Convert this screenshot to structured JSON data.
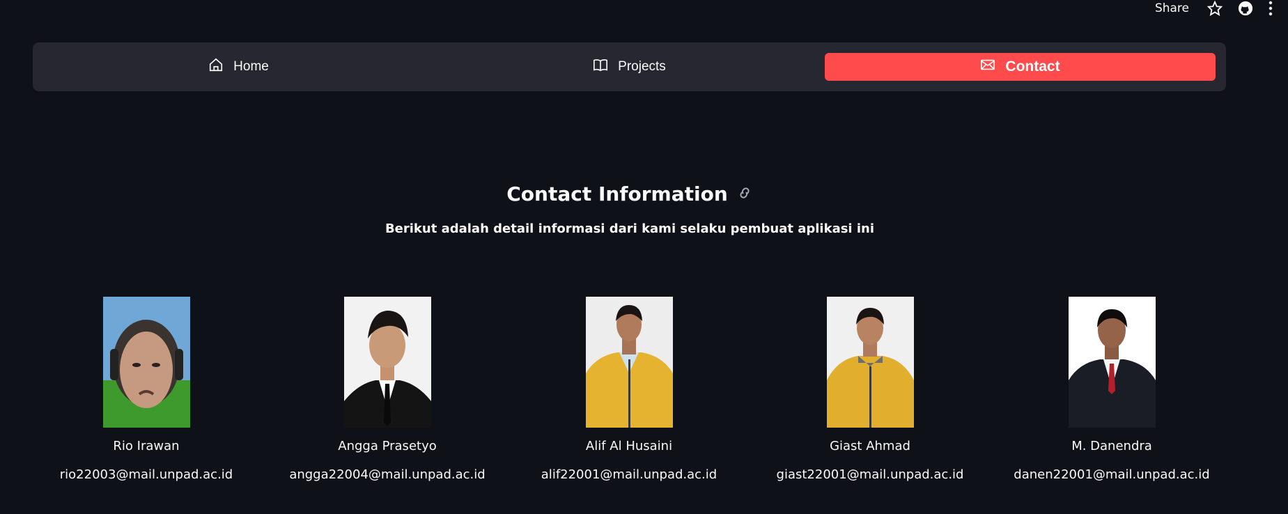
{
  "topbar": {
    "share_label": "Share"
  },
  "nav": {
    "items": [
      {
        "label": "Home",
        "icon": "home-icon"
      },
      {
        "label": "Projects",
        "icon": "book-icon"
      },
      {
        "label": "Contact",
        "icon": "envelope-icon",
        "active": true
      }
    ],
    "active_color": "#ff4b4b"
  },
  "main": {
    "title": "Contact Information",
    "subtitle": "Berikut adalah detail informasi dari kami selaku pembuat aplikasi ini"
  },
  "contacts": [
    {
      "name": "Rio Irawan",
      "email": "rio22003@mail.unpad.ac.id"
    },
    {
      "name": "Angga Prasetyo",
      "email": "angga22004@mail.unpad.ac.id"
    },
    {
      "name": "Alif Al Husaini",
      "email": "alif22001@mail.unpad.ac.id"
    },
    {
      "name": "Giast Ahmad",
      "email": "giast22001@mail.unpad.ac.id"
    },
    {
      "name": "M. Danendra",
      "email": "danen22001@mail.unpad.ac.id"
    }
  ]
}
